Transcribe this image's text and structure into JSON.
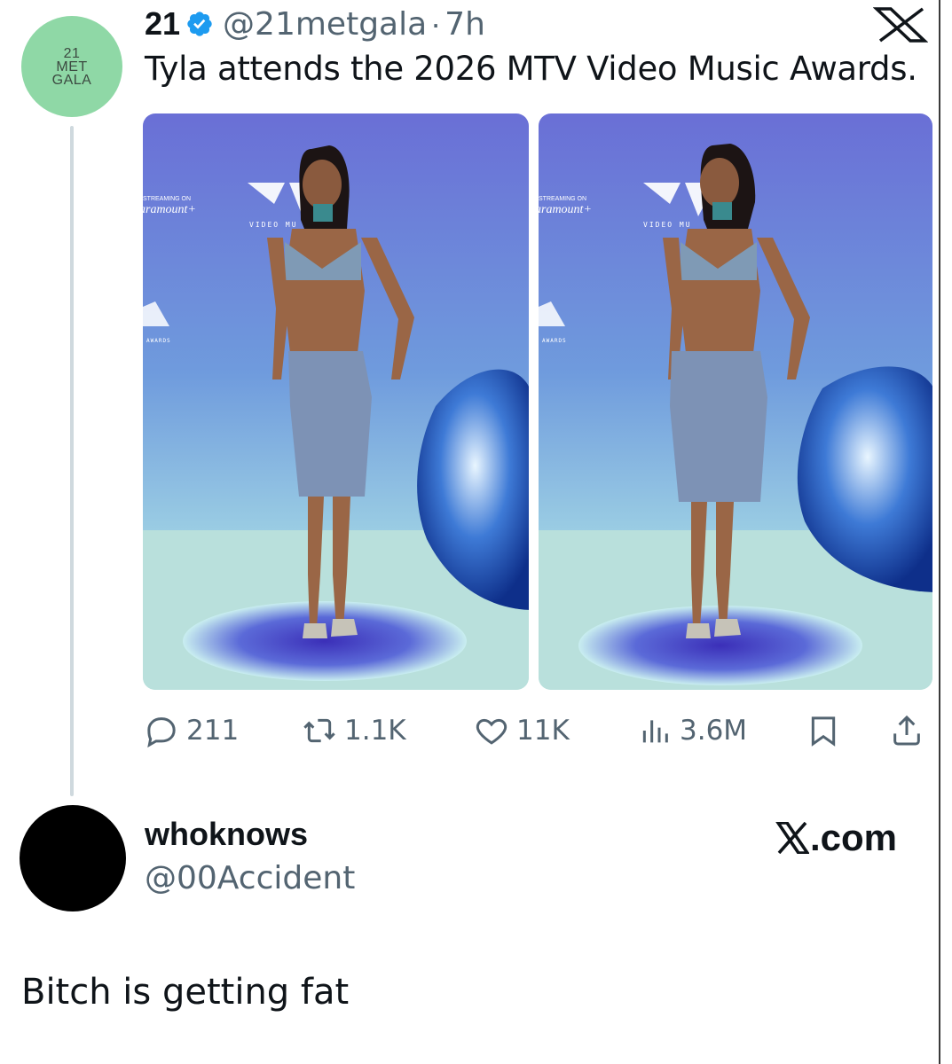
{
  "tweet": {
    "avatar_text": [
      "21",
      "MET",
      "GALA"
    ],
    "display_name": "21",
    "handle": "@21metgala",
    "separator": "·",
    "time": "7h",
    "text": "Tyla attends the 2026 MTV Video Music Awards.",
    "verified_color": "#1d9bf0"
  },
  "photos": [
    {
      "banner_small": "STREAMING ON",
      "banner_brand": "aramount+",
      "banner_video": "VIDEO MU",
      "banner_awards": "AWARDS"
    },
    {
      "banner_small": "STREAMING ON",
      "banner_brand": "aramount+",
      "banner_video": "VIDEO MU",
      "banner_awards": "AWARDS"
    }
  ],
  "actions": {
    "replies": "211",
    "reposts": "1.1K",
    "likes": "11K",
    "views": "3.6M"
  },
  "reply_user": {
    "name": "whoknows",
    "handle": "@00Accident",
    "site": ".com",
    "comment": "Bitch is getting fat"
  },
  "colors": {
    "accent_blue": "#1d9bf0",
    "muted": "#536471",
    "avatar_green": "#8fd8a6"
  }
}
